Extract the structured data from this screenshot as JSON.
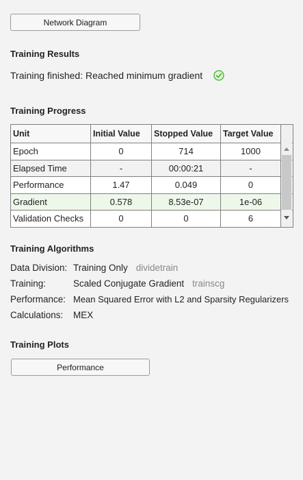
{
  "buttons": {
    "network_diagram": "Network Diagram",
    "performance_plot": "Performance"
  },
  "results": {
    "title": "Training Results",
    "status": "Training finished: Reached minimum gradient",
    "status_icon": "check-circle-icon",
    "status_color": "#3cb22c"
  },
  "progress": {
    "title": "Training Progress",
    "headers": [
      "Unit",
      "Initial Value",
      "Stopped Value",
      "Target Value"
    ],
    "rows": [
      {
        "unit": "Epoch",
        "initial": "0",
        "stopped": "714",
        "target": "1000"
      },
      {
        "unit": "Elapsed Time",
        "initial": "-",
        "stopped": "00:00:21",
        "target": "-"
      },
      {
        "unit": "Performance",
        "initial": "1.47",
        "stopped": "0.049",
        "target": "0"
      },
      {
        "unit": "Gradient",
        "initial": "0.578",
        "stopped": "8.53e-07",
        "target": "1e-06"
      },
      {
        "unit": "Validation Checks",
        "initial": "0",
        "stopped": "0",
        "target": "6"
      }
    ]
  },
  "algorithms": {
    "title": "Training Algorithms",
    "items": [
      {
        "label": "Data Division:",
        "value": "Training Only",
        "fn": "dividetrain"
      },
      {
        "label": "Training:",
        "value": "Scaled Conjugate Gradient",
        "fn": "trainscg"
      },
      {
        "label": "Performance:",
        "value": "Mean Squared Error with L2 and Sparsity Regularizers",
        "fn": ""
      },
      {
        "label": "Calculations:",
        "value": "MEX",
        "fn": ""
      }
    ]
  },
  "plots": {
    "title": "Training Plots"
  }
}
